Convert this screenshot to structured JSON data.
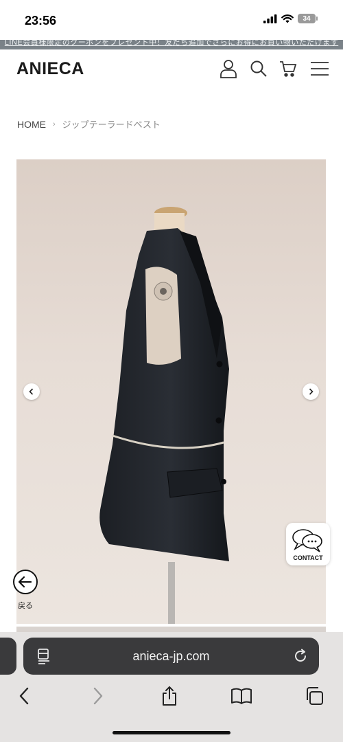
{
  "status_bar": {
    "time": "23:56",
    "battery": "34"
  },
  "announcement": {
    "text": "LINE会員様限定のクーポンをプレゼント中！友だち追加でさらにお得にお買い物いただけます"
  },
  "header": {
    "brand": "ANIECA",
    "icons": [
      "account-icon",
      "search-icon",
      "cart-icon",
      "menu-icon"
    ]
  },
  "breadcrumb": {
    "home": "HOME",
    "separator": "›",
    "current": "ジップテーラードベスト"
  },
  "gallery": {
    "prev_icon": "chevron-left-icon",
    "next_icon": "chevron-right-icon"
  },
  "contact": {
    "label": "CONTACT",
    "icon": "chat-bubbles-icon"
  },
  "back": {
    "label": "戻る",
    "icon": "arrow-left-circle-icon"
  },
  "browser": {
    "url": "anieca-jp.com",
    "toolbar_icons": [
      "back-icon",
      "forward-icon",
      "share-icon",
      "bookmarks-icon",
      "tabs-icon"
    ]
  },
  "colors": {
    "accent": "#1a1a1a",
    "url_pill": "#3a3a3c",
    "toolbar_bg": "#e5e3e2"
  }
}
